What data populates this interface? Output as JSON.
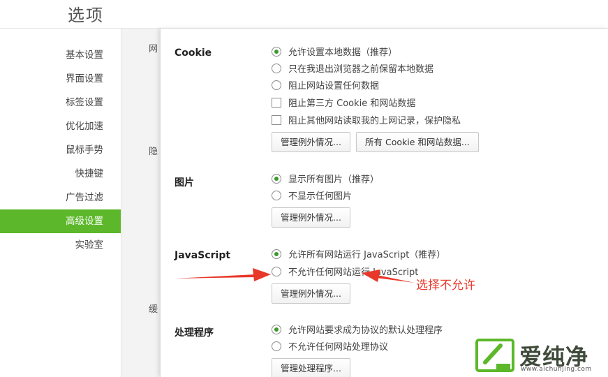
{
  "window": {
    "title": "选项"
  },
  "sidebar": {
    "items": [
      {
        "label": "基本设置"
      },
      {
        "label": "界面设置"
      },
      {
        "label": "标签设置"
      },
      {
        "label": "优化加速"
      },
      {
        "label": "鼠标手势"
      },
      {
        "label": "快捷键"
      },
      {
        "label": "广告过滤"
      },
      {
        "label": "高级设置",
        "active": true
      },
      {
        "label": "实验室"
      }
    ]
  },
  "background_peek": [
    "网",
    "隐",
    "缓"
  ],
  "dialog": {
    "cookie": {
      "label": "Cookie",
      "options": [
        "允许设置本地数据（推荐）",
        "只在我退出浏览器之前保留本地数据",
        "阻止网站设置任何数据",
        "阻止第三方 Cookie 和网站数据",
        "阻止其他网站读取我的上网记录，保护隐私"
      ],
      "selected_index": 0,
      "buttons": [
        "管理例外情况...",
        "所有 Cookie 和网站数据..."
      ]
    },
    "images": {
      "label": "图片",
      "options": [
        "显示所有图片（推荐）",
        "不显示任何图片"
      ],
      "selected_index": 0,
      "button": "管理例外情况..."
    },
    "javascript": {
      "label": "JavaScript",
      "options": [
        "允许所有网站运行 JavaScript（推荐）",
        "不允许任何网站运行 JavaScript"
      ],
      "selected_index": 0,
      "button": "管理例外情况..."
    },
    "handlers": {
      "label": "处理程序",
      "options": [
        "允许网站要求成为协议的默认处理程序",
        "不允许任何网站处理协议"
      ],
      "selected_index": 0,
      "button": "管理处理程序..."
    }
  },
  "annotation": {
    "text": "选择不允许",
    "color": "#e8382a"
  },
  "watermark": {
    "title": "爱纯净",
    "url": "www.aichunjing.com",
    "color": "#5cb82a"
  },
  "colors": {
    "accent": "#5cb82a",
    "radio_dot": "#3b9b2a"
  }
}
